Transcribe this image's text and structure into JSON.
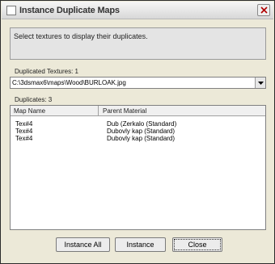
{
  "window": {
    "title": "Instance Duplicate Maps"
  },
  "info": {
    "text": "Select textures to display their duplicates."
  },
  "duplicated_textures": {
    "label": "Duplicated Textures: 1",
    "selected": "C:\\3dsmax6\\maps\\Wood\\BURLOAK.jpg"
  },
  "duplicates": {
    "label": "Duplicates: 3",
    "columns": [
      "Map Name",
      "Parent Material"
    ],
    "rows": [
      {
        "map_name": "Tex#4",
        "parent_material": "Dub (Zerkalo (Standard)"
      },
      {
        "map_name": "Tex#4",
        "parent_material": "Dubovly kap (Standard)"
      },
      {
        "map_name": "Tex#4",
        "parent_material": "Dubovly kap (Standard)"
      }
    ]
  },
  "buttons": {
    "instance_all": "Instance All",
    "instance": "Instance",
    "close": "Close"
  },
  "icons": {
    "window_icon": "window-icon",
    "close_icon": "close-icon",
    "dropdown_icon": "chevron-down-icon"
  }
}
